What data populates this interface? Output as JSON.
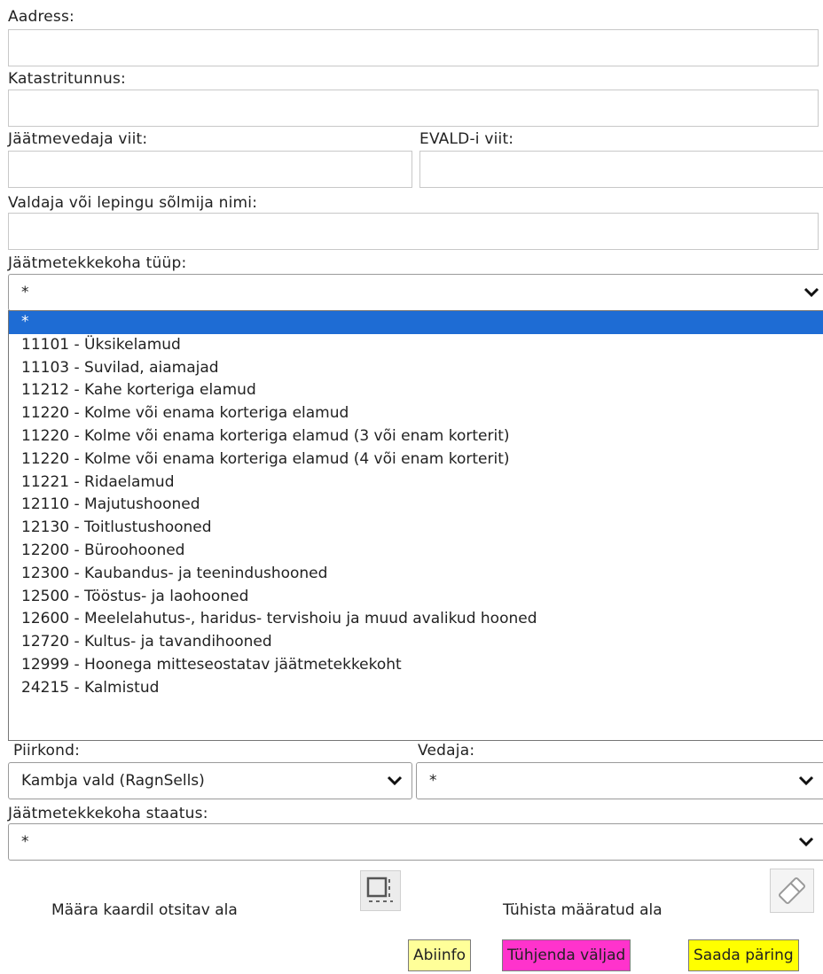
{
  "labels": {
    "aadress": "Aadress:",
    "katastritunnus": "Katastritunnus:",
    "jaatmevedaja_viit": "Jäätmevedaja viit:",
    "evald_viit": "EVALD-i viit:",
    "valdaja": "Valdaja või lepingu sõlmija nimi:",
    "tyyp": "Jäätmetekkekoha tüüp:",
    "piirkond": "Piirkond:",
    "vedaja": "Vedaja:",
    "staatus": "Jäätmetekkekoha staatus:"
  },
  "fields": {
    "aadress_value": "",
    "katastritunnus_value": "",
    "jaatmevedaja_viit_value": "",
    "evald_viit_value": "",
    "valdaja_value": ""
  },
  "selects": {
    "tyyp_selected": "*",
    "piirkond_selected": "Kambja vald (RagnSells)",
    "vedaja_selected": "*",
    "staatus_selected": "*"
  },
  "tyyp_options": [
    "*",
    "11101 - Üksikelamud",
    "11103 - Suvilad, aiamajad",
    "11212 - Kahe korteriga elamud",
    "11220 - Kolme või enama korteriga elamud",
    "11220 - Kolme või enama korteriga elamud (3 või enam korterit)",
    "11220 - Kolme või enama korteriga elamud (4 või enam korterit)",
    "11221 - Ridaelamud",
    "12110 - Majutushooned",
    "12130 - Toitlustushooned",
    "12200 - Büroohooned",
    "12300 - Kaubandus- ja teenindushooned",
    "12500 - Tööstus- ja laohooned",
    "12600 - Meelelahutus-, haridus- tervishoiu ja muud avalikud hooned",
    "12720 - Kultus- ja tavandihooned",
    "12999 - Hoonega mitteseostatav jäätmetekkekoht",
    "24215 - Kalmistud"
  ],
  "tools": {
    "define_area_label": "Määra kaardil otsitav ala",
    "define_area_icon": "select-area-icon",
    "clear_area_label": "Tühista määratud ala",
    "clear_area_icon": "eraser-icon"
  },
  "buttons": {
    "help": "Abiinfo",
    "clear": "Tühjenda väljad",
    "submit": "Saada päring"
  },
  "colors": {
    "help_bg": "#ffff99",
    "clear_bg": "#ff33cc",
    "submit_bg": "#ffff00",
    "option_highlight": "#1e6cd4"
  }
}
